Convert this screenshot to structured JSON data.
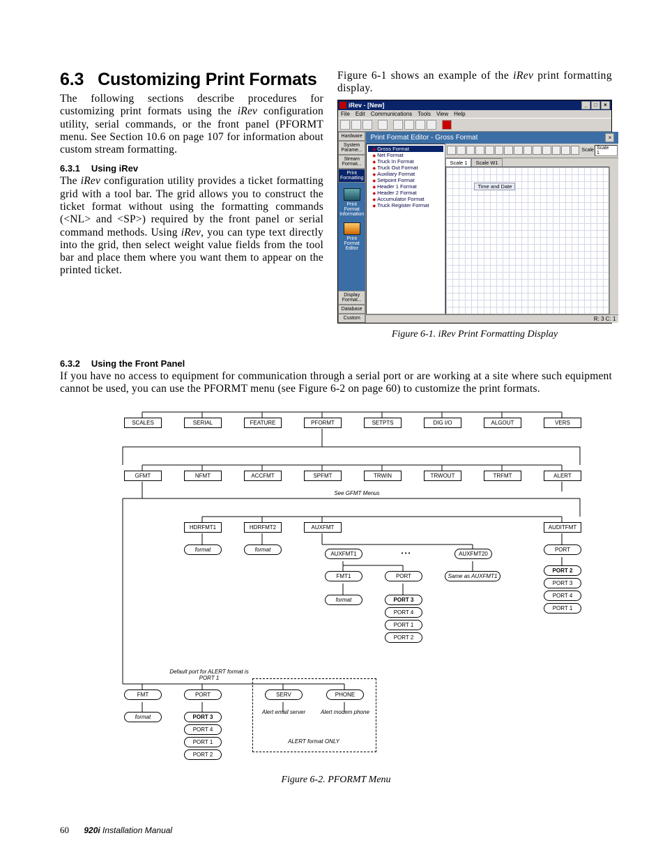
{
  "section": {
    "number": "6.3",
    "title": "Customizing Print Formats"
  },
  "para_left_intro": "The following sections describe procedures for customizing print formats using the iRev configuration utility, serial commands, or the front panel (PFORMT menu. See Section 10.6 on page 107 for information about custom stream formatting.",
  "sub1": {
    "number": "6.3.1",
    "title": "Using iRev"
  },
  "para_sub1": "The iRev configuration utility provides a ticket formatting grid with a tool bar. The grid allows you to construct the ticket format without using the formatting commands (<NL> and <SP>) required by the front panel or serial command methods. Using iRev, you can type text directly into the grid, then select weight value fields from the tool bar and place them where you want them to appear on the printed ticket.",
  "para_right_intro": "Figure 6-1 shows an example of the iRev print formatting display.",
  "fig1_caption": "Figure 6-1. iRev Print Formatting Display",
  "app": {
    "title": "iRev - [New]",
    "menus": [
      "File",
      "Edit",
      "Communications",
      "Tools",
      "View",
      "Help"
    ],
    "side_buttons_top": [
      "Hardware",
      "System Parame...",
      "Stream Format...",
      "Print Formatting"
    ],
    "side_labels": [
      "Print Format Information",
      "Print Format Editor"
    ],
    "side_buttons_bottom": [
      "Display Format...",
      "Database",
      "Custom"
    ],
    "editor_title": "Print Format Editor - Gross Format",
    "tree": [
      "Gross Format",
      "Net Format",
      "Truck In Format",
      "Truck Out Format",
      "Auxiliary Format",
      "Setpoint Format",
      "Header 1 Format",
      "Header 2 Format",
      "Accumulator Format",
      "Truck Register Format"
    ],
    "tabs": [
      "Scale 1",
      "Scale W1"
    ],
    "scale_label": "Scale 1",
    "grid_field": "Time and Date",
    "status_right": "R: 3  C: 1"
  },
  "sub2": {
    "number": "6.3.2",
    "title": "Using the Front Panel"
  },
  "para_sub2": "If you have no access to equipment for communication through a serial port or are working at a site where such equipment cannot be used, you can use the PFORMT menu (see Figure 6-2 on page 60) to customize the print formats.",
  "diagram": {
    "row1": [
      "SCALES",
      "SERIAL",
      "FEATURE",
      "PFORMT",
      "SETPTS",
      "DIG I/O",
      "ALGOUT",
      "VERS"
    ],
    "row2": [
      "GFMT",
      "NFMT",
      "ACCFMT",
      "SPFMT",
      "TRWIN",
      "TRWOUT",
      "TRFMT",
      "ALERT"
    ],
    "note_gfmt": "See GFMT Menus",
    "row3": [
      "HDRFMT1",
      "HDRFMT2",
      "AUXFMT",
      "AUDITFMT"
    ],
    "ovals_row3": [
      "format",
      "format"
    ],
    "aux_row": [
      "AUXFMT1",
      "AUXFMT20"
    ],
    "aux_ell": "• • •",
    "aux_row2": [
      "FMT1",
      "PORT"
    ],
    "aux_same": "Same as AUXFMT1",
    "aux_oval": "format",
    "aux_ports": [
      "PORT 3",
      "PORT 4",
      "PORT 1",
      "PORT 2"
    ],
    "audit_port": "PORT",
    "audit_ports": [
      "PORT 2",
      "PORT 3",
      "PORT 4",
      "PORT 1"
    ],
    "alert_note": "Default port for ALERT format is PORT 1",
    "alert_row": [
      "FMT",
      "PORT",
      "SERV",
      "PHONE"
    ],
    "alert_oval": "format",
    "alert_ports": [
      "PORT 3",
      "PORT 4",
      "PORT 1",
      "PORT 2"
    ],
    "alert_serv": "Alert email server",
    "alert_phone": "Alert modem phone",
    "alert_only": "ALERT format ONLY"
  },
  "fig2_caption": "Figure 6-2. PFORMT Menu",
  "footer": {
    "page": "60",
    "model": "920i",
    "manual": " Installation Manual"
  }
}
